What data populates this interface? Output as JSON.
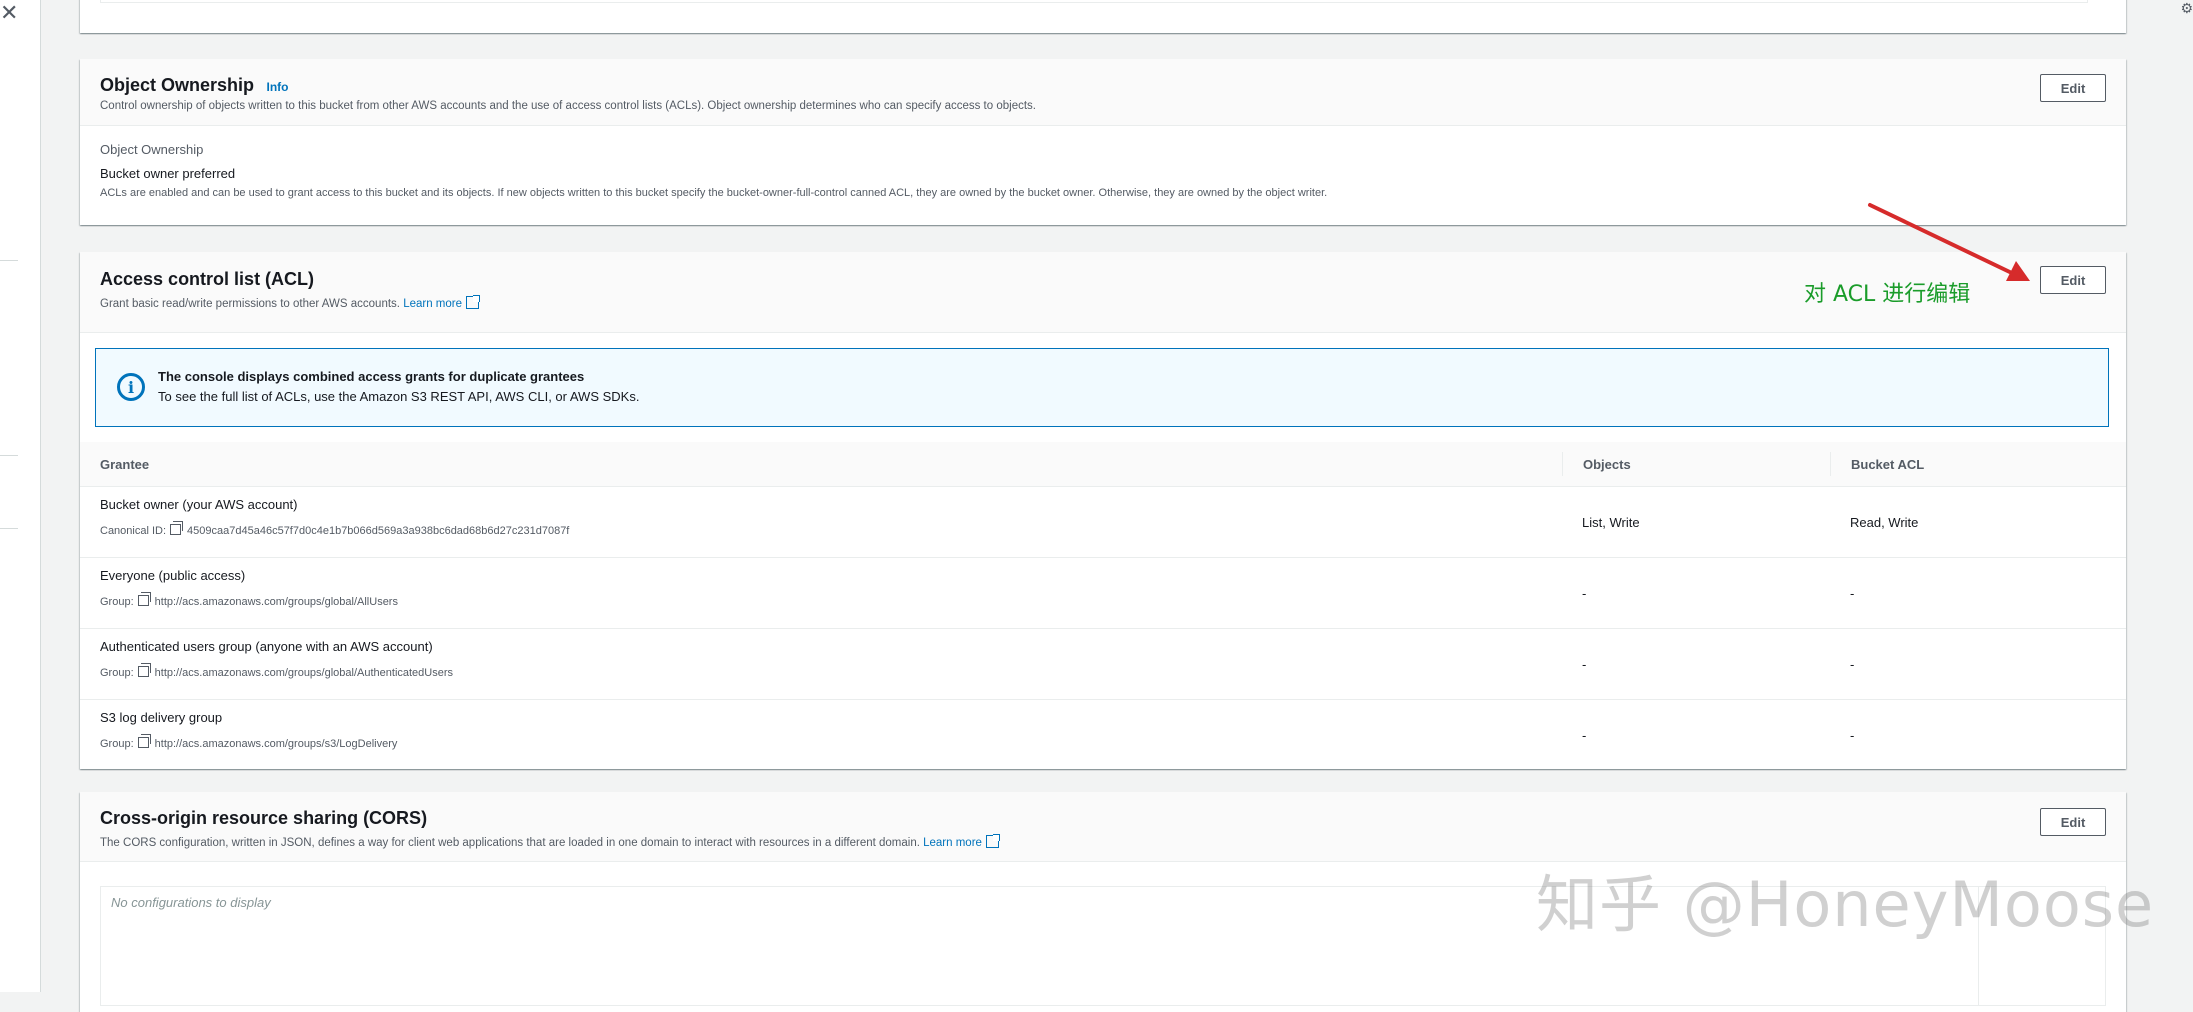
{
  "annotation": {
    "text": "对 ACL 进行编辑",
    "color": "#d62b2b",
    "text_color": "#1a9c2a"
  },
  "object_ownership": {
    "title": "Object Ownership",
    "info": "Info",
    "description": "Control ownership of objects written to this bucket from other AWS accounts and the use of access control lists (ACLs). Object ownership determines who can specify access to objects.",
    "edit_label": "Edit",
    "field_label": "Object Ownership",
    "field_value": "Bucket owner preferred",
    "field_note": "ACLs are enabled and can be used to grant access to this bucket and its objects. If new objects written to this bucket specify the bucket-owner-full-control canned ACL, they are owned by the bucket owner. Otherwise, they are owned by the object writer."
  },
  "acl": {
    "title": "Access control list (ACL)",
    "description": "Grant basic read/write permissions to other AWS accounts.",
    "learn_more": "Learn more",
    "edit_label": "Edit",
    "flash": {
      "title": "The console displays combined access grants for duplicate grantees",
      "text": "To see the full list of ACLs, use the Amazon S3 REST API, AWS CLI, or AWS SDKs."
    },
    "columns": [
      "Grantee",
      "Objects",
      "Bucket ACL"
    ],
    "rows": [
      {
        "grantee": "Bucket owner (your AWS account)",
        "sub_label": "Canonical ID:",
        "sub_value": "4509caa7d45a46c57f7d0c4e1b7b066d569a3a938bc6dad68b6d27c231d7087f",
        "objects": "List, Write",
        "bucket_acl": "Read, Write"
      },
      {
        "grantee": "Everyone (public access)",
        "sub_label": "Group:",
        "sub_value": "http://acs.amazonaws.com/groups/global/AllUsers",
        "objects": "-",
        "bucket_acl": "-"
      },
      {
        "grantee": "Authenticated users group (anyone with an AWS account)",
        "sub_label": "Group:",
        "sub_value": "http://acs.amazonaws.com/groups/global/AuthenticatedUsers",
        "objects": "-",
        "bucket_acl": "-"
      },
      {
        "grantee": "S3 log delivery group",
        "sub_label": "Group:",
        "sub_value": "http://acs.amazonaws.com/groups/s3/LogDelivery",
        "objects": "-",
        "bucket_acl": "-"
      }
    ]
  },
  "cors": {
    "title": "Cross-origin resource sharing (CORS)",
    "description": "The CORS configuration, written in JSON, defines a way for client web applications that are loaded in one domain to interact with resources in a different domain.",
    "learn_more": "Learn more",
    "edit_label": "Edit",
    "empty_text": "No configurations to display"
  },
  "watermark": "知乎 @HoneyMoose"
}
